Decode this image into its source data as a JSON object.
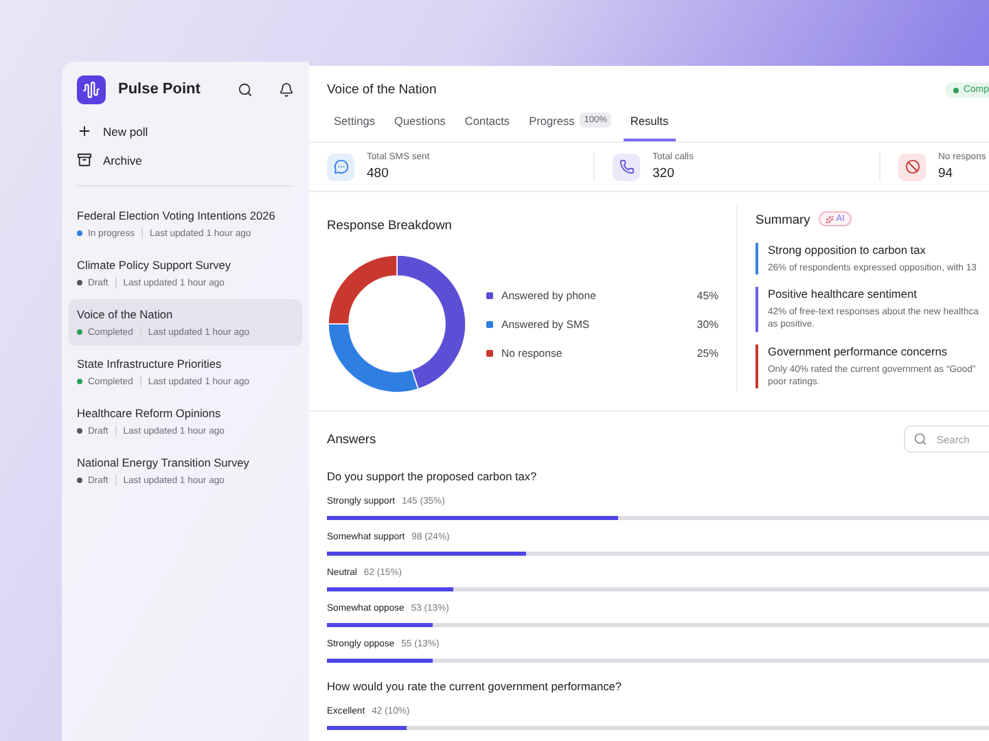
{
  "sidebar": {
    "app_name": "Pulse Point",
    "actions": [
      {
        "kind": "new",
        "label": "New poll"
      },
      {
        "kind": "archive",
        "label": "Archive"
      }
    ],
    "polls": [
      {
        "title": "Federal Election Voting Intentions 2026",
        "status": "In progress",
        "color": "#2f7fe3",
        "updated": "Last updated 1 hour ago",
        "selected": false
      },
      {
        "title": "Climate Policy Support Survey",
        "status": "Draft",
        "color": "#55555f",
        "updated": "Last updated 1 hour ago",
        "selected": false
      },
      {
        "title": "Voice of the Nation",
        "status": "Completed",
        "color": "#2e9e5b",
        "updated": "Last updated 1 hour ago",
        "selected": true
      },
      {
        "title": "State Infrastructure Priorities",
        "status": "Completed",
        "color": "#2e9e5b",
        "updated": "Last updated 1 hour ago",
        "selected": false
      },
      {
        "title": "Healthcare Reform Opinions",
        "status": "Draft",
        "color": "#55555f",
        "updated": "Last updated 1 hour ago",
        "selected": false
      },
      {
        "title": "National Energy Transition Survey",
        "status": "Draft",
        "color": "#55555f",
        "updated": "Last updated 1 hour ago",
        "selected": false
      }
    ]
  },
  "main": {
    "title": "Voice of the Nation",
    "status_badge": "Comp",
    "tabs": [
      {
        "label": "Settings",
        "selected": false
      },
      {
        "label": "Questions",
        "selected": false
      },
      {
        "label": "Contacts",
        "selected": false
      },
      {
        "label": "Progress",
        "badge": "100%",
        "selected": false
      },
      {
        "label": "Results",
        "selected": true
      }
    ],
    "stats": [
      {
        "kind": "sms",
        "label": "Total SMS sent",
        "value": "480"
      },
      {
        "kind": "calls",
        "label": "Total calls",
        "value": "320"
      },
      {
        "kind": "none",
        "label": "No respons",
        "value": "94"
      }
    ],
    "breakdown": {
      "title": "Response Breakdown",
      "chart_data": {
        "type": "donut",
        "categories": [
          "Answered by phone",
          "Answered by SMS",
          "No response"
        ],
        "values": [
          45,
          30,
          25
        ]
      },
      "legend": [
        {
          "value": "45%",
          "color": "#5b4fd6"
        },
        {
          "value": "30%",
          "color": "#2f7fe3"
        },
        {
          "value": "25%",
          "color": "#c9382f"
        }
      ]
    },
    "summary": {
      "title": "Summary",
      "badge": "AI",
      "items": [
        {
          "title": "Strong opposition to carbon tax",
          "lines": [
            "26% of respondents expressed opposition, with 13"
          ],
          "color": "#3b82e0"
        },
        {
          "title": "Positive healthcare sentiment",
          "lines": [
            "42% of free-text responses about the new healthca",
            "as positive."
          ],
          "color": "#6b5ce7"
        },
        {
          "title": "Government performance concerns",
          "lines": [
            "Only 40% rated the current government as “Good”",
            "poor ratings."
          ],
          "color": "#c9382f"
        }
      ]
    },
    "answers": {
      "title": "Answers",
      "search": {
        "placeholder": "Search"
      },
      "questions": [
        {
          "question": "Do you support the proposed carbon tax?",
          "options": [
            {
              "label": "Strongly support",
              "count": "145 (35%)",
              "level": 0.44
            },
            {
              "label": "Somewhat support",
              "count": "98 (24%)",
              "level": 0.3
            },
            {
              "label": "Neutral",
              "count": "62 (15%)",
              "level": 0.19
            },
            {
              "label": "Somewhat oppose",
              "count": "53 (13%)",
              "level": 0.16
            },
            {
              "label": "Strongly oppose",
              "count": "55 (13%)",
              "level": 0.16
            }
          ]
        },
        {
          "question": "How would you rate the current government performance?",
          "options": [
            {
              "label": "Excellent",
              "count": "42 (10%)",
              "level": 0.12
            }
          ]
        }
      ]
    }
  }
}
